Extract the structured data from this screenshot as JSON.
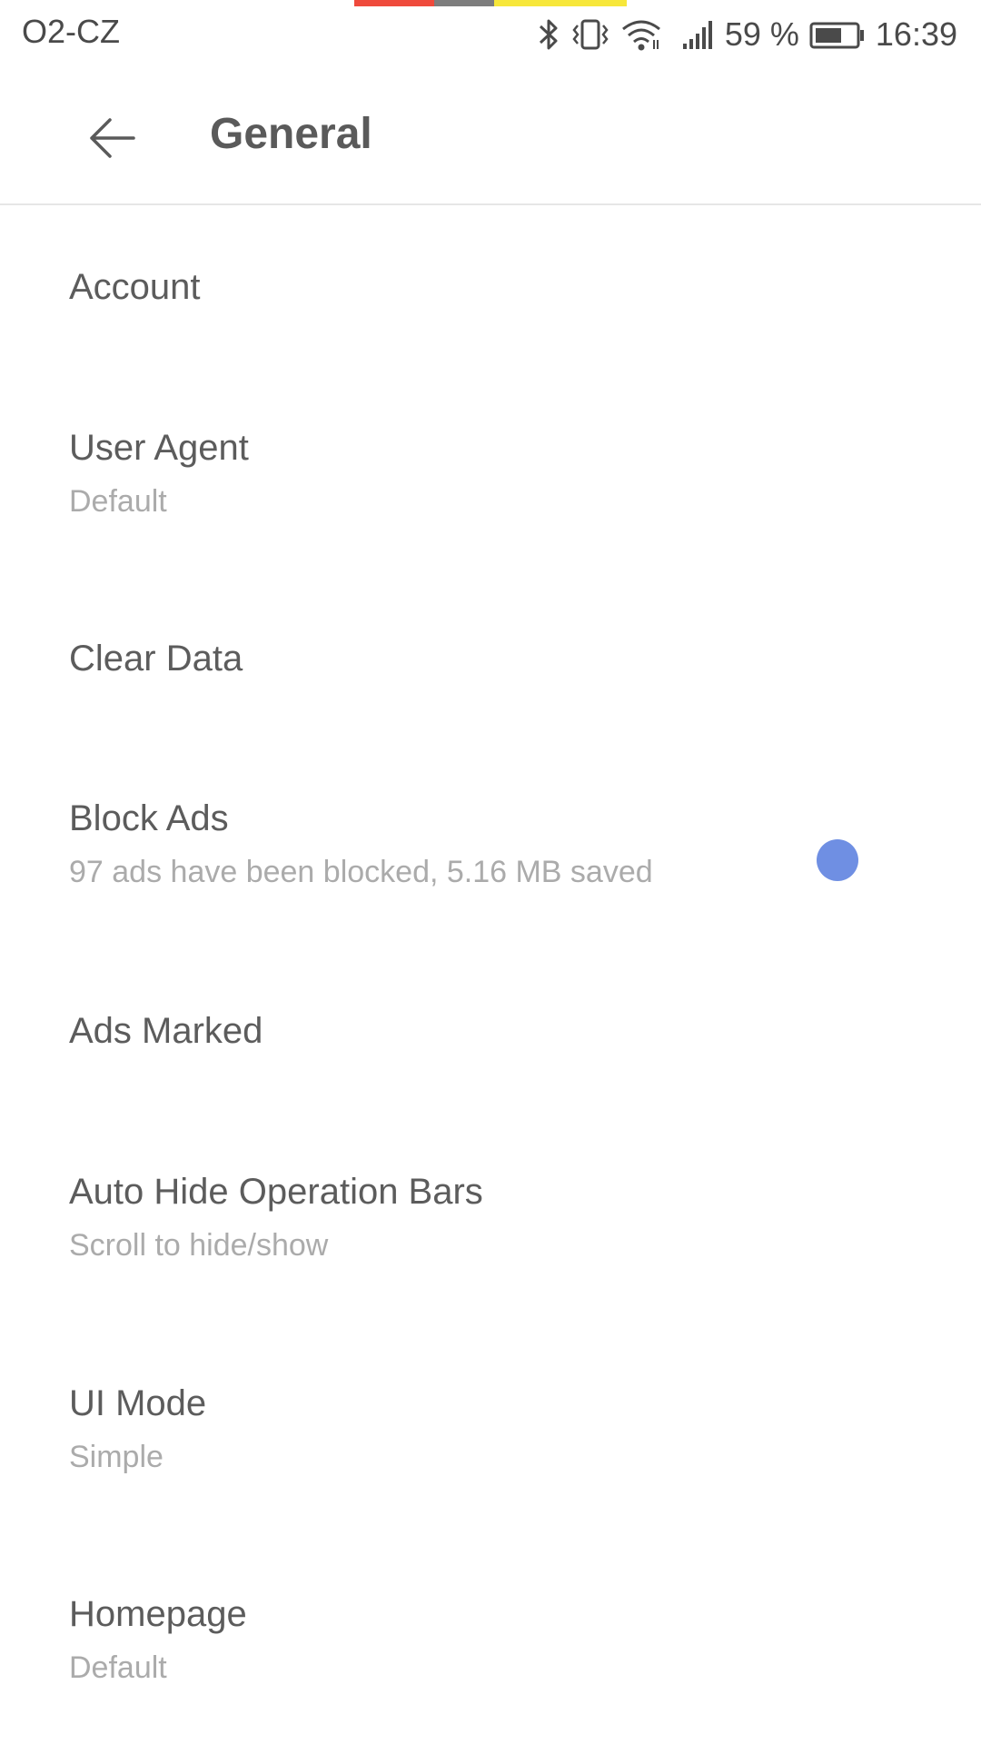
{
  "status_bar": {
    "carrier": "O2-CZ",
    "battery_percent": "59 %",
    "time": "16:39",
    "icons": [
      "bluetooth-icon",
      "vibrate-icon",
      "wifi-icon",
      "signal-icon",
      "battery-icon"
    ]
  },
  "colors": {
    "strip_red": "#ef4a3c",
    "strip_gray": "#7d7d7d",
    "strip_yellow": "#f7e73a",
    "accent": "#6f8fe3"
  },
  "app_bar": {
    "title": "General",
    "back_icon": "arrow-left-icon"
  },
  "settings": [
    {
      "title": "Account",
      "subtitle": ""
    },
    {
      "title": "User Agent",
      "subtitle": "Default"
    },
    {
      "title": "Clear Data",
      "subtitle": ""
    },
    {
      "title": "Block Ads",
      "subtitle": "97 ads have been blocked, 5.16 MB saved",
      "toggle": true
    },
    {
      "title": "Ads Marked",
      "subtitle": ""
    },
    {
      "title": "Auto Hide Operation Bars",
      "subtitle": "Scroll to hide/show"
    },
    {
      "title": "UI Mode",
      "subtitle": "Simple"
    },
    {
      "title": "Homepage",
      "subtitle": "Default"
    }
  ]
}
